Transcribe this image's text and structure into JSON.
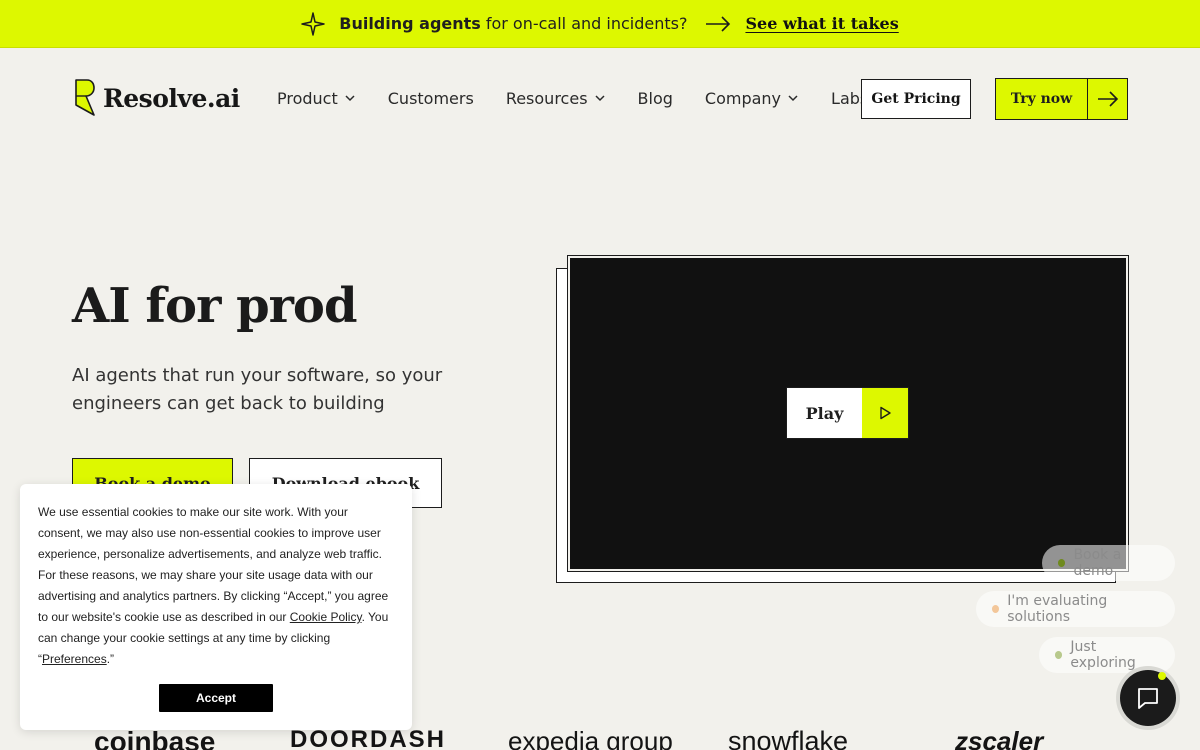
{
  "announcement": {
    "bold": "Building agents",
    "rest": "for on-call and incidents?",
    "cta": "See what it takes"
  },
  "brand": {
    "name": "Resolve.ai",
    "accent": "#ddf800"
  },
  "nav": {
    "items": [
      {
        "label": "Product",
        "dropdown": true
      },
      {
        "label": "Customers",
        "dropdown": false
      },
      {
        "label": "Resources",
        "dropdown": true
      },
      {
        "label": "Blog",
        "dropdown": false
      },
      {
        "label": "Company",
        "dropdown": true
      },
      {
        "label": "Labs",
        "dropdown": false
      }
    ],
    "pricing": "Get Pricing",
    "try": "Try now"
  },
  "hero": {
    "title": "AI for prod",
    "subtitle": "AI agents that run your software, so your engineers can get back to building",
    "primary": "Book a demo",
    "secondary": "Download ebook"
  },
  "video": {
    "play": "Play"
  },
  "cookie": {
    "text_before": "We use essential cookies to make our site work. With your consent, we may also use non-essential cookies to improve user experience, personalize advertisements, and analyze web traffic. For these reasons, we may share your site usage data with our advertising and analytics partners. By clicking “Accept,” you agree to our website's cookie use as described in our ",
    "policy_link": "Cookie Policy",
    "text_middle": ". You can change your cookie settings at any time by clicking “",
    "prefs_link": "Preferences",
    "text_end": ".”",
    "accept": "Accept"
  },
  "chat": {
    "chips": [
      {
        "label": "Book a demo",
        "dot": "#6f8a1e"
      },
      {
        "label": "I'm evaluating solutions",
        "dot": "#f3c79a"
      },
      {
        "label": "Just exploring",
        "dot": "#b8c98c"
      }
    ]
  },
  "logos": [
    "coinbase",
    "DOORDASH",
    "expedia group",
    "snowflake",
    "zscaler"
  ]
}
